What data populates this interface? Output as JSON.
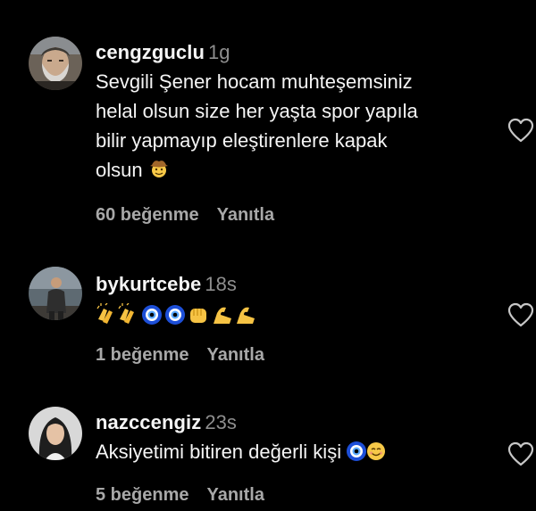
{
  "comments": [
    {
      "username": "cengzguclu",
      "time": "1g",
      "text_lines": [
        "Sevgili Şener hocam muhteşemsiniz",
        "helal olsun size her yaşta spor yapıla",
        "bilir yapmayıp eleştirenlere kapak",
        "olsun"
      ],
      "emoji": "cowboy-face",
      "likes": "60 beğenme",
      "reply": "Yanıtla",
      "avatar_icon": "man-grey-beard-avatar"
    },
    {
      "username": "bykurtcebe",
      "time": "18s",
      "text_lines": [],
      "emoji": "clapping-hands x2, nazar-amulet x2, fist, flexed-biceps x2",
      "likes": "1 beğenme",
      "reply": "Yanıtla",
      "avatar_icon": "man-standing-avatar"
    },
    {
      "username": "nazccengiz",
      "time": "23s",
      "text_lines": [
        "Aksiyetimi bitiren değerli kişi"
      ],
      "emoji": "nazar-amulet, smiling-face",
      "likes": "5 beğenme",
      "reply": "Yanıtla",
      "avatar_icon": "woman-avatar"
    }
  ],
  "colors": {
    "background": "#000000",
    "text": "#f5f5f5",
    "secondary": "#8e8e8e",
    "actions": "#a8a8a8"
  },
  "icons": {
    "like": "heart-outline-icon"
  }
}
